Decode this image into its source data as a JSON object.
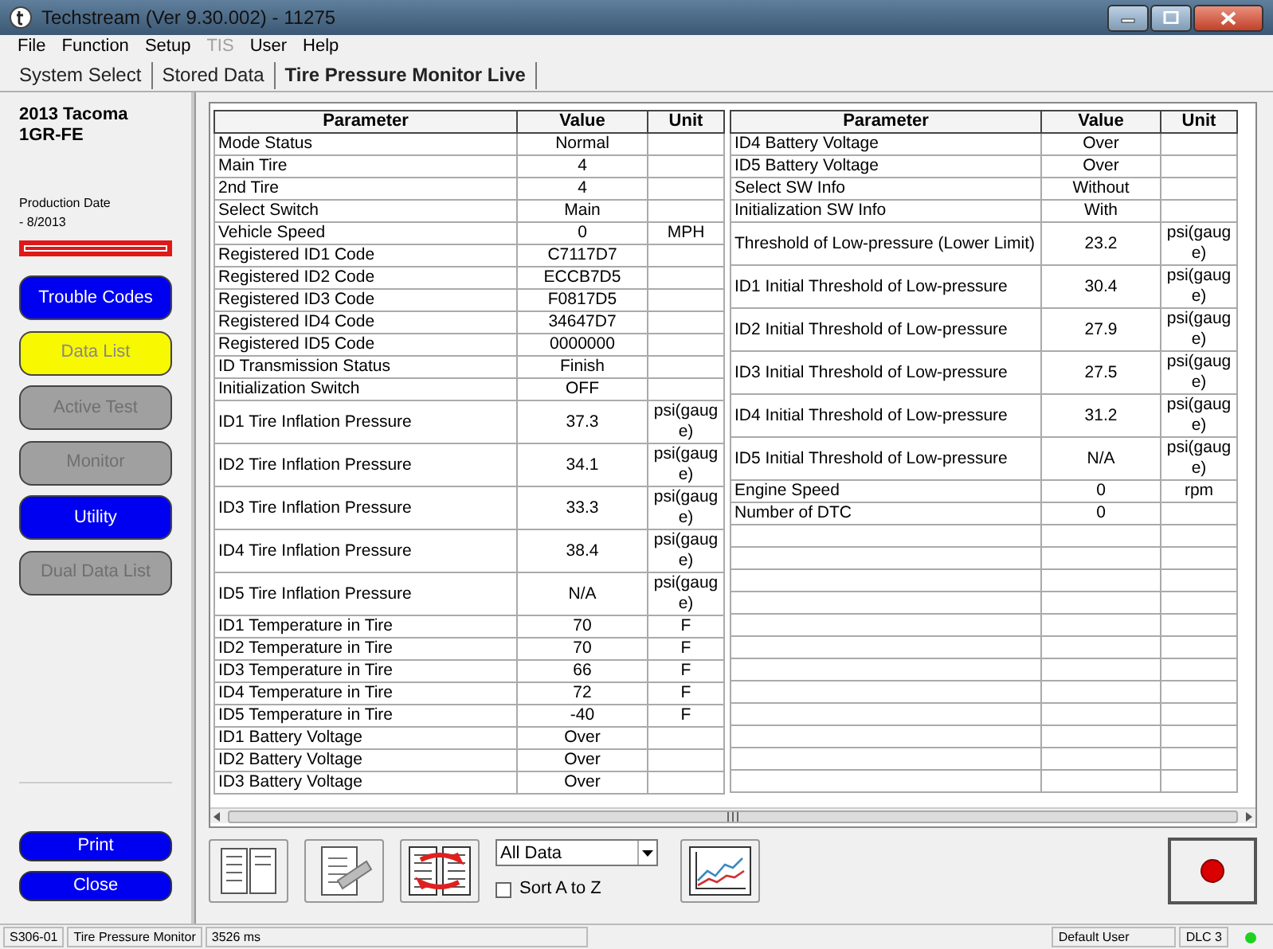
{
  "window": {
    "title": "Techstream (Ver 9.30.002) - 11275"
  },
  "menu": [
    {
      "label": "File",
      "disabled": false
    },
    {
      "label": "Function",
      "disabled": false
    },
    {
      "label": "Setup",
      "disabled": false
    },
    {
      "label": "TIS",
      "disabled": true
    },
    {
      "label": "User",
      "disabled": false
    },
    {
      "label": "Help",
      "disabled": false
    }
  ],
  "tabs": [
    {
      "label": "System Select",
      "selected": false
    },
    {
      "label": "Stored Data",
      "selected": false
    },
    {
      "label": "Tire Pressure Monitor Live",
      "selected": true
    }
  ],
  "vehicle": {
    "model": "2013 Tacoma",
    "engine": "1GR-FE",
    "production_label": "Production Date",
    "production_value": "- 8/2013"
  },
  "function_buttons": [
    {
      "label": "Trouble Codes",
      "selected": false,
      "disabled": false
    },
    {
      "label": "Data List",
      "selected": true,
      "disabled": false
    },
    {
      "label": "Active Test",
      "selected": false,
      "disabled": true
    },
    {
      "label": "Monitor",
      "selected": false,
      "disabled": true
    },
    {
      "label": "Utility",
      "selected": false,
      "disabled": false
    },
    {
      "label": "Dual Data List",
      "selected": false,
      "disabled": true
    }
  ],
  "action_buttons": [
    "Print",
    "Close"
  ],
  "tables": [
    {
      "columns": [
        "Parameter",
        "Value",
        "Unit"
      ],
      "rows": [
        {
          "parameter": "Mode Status",
          "value": "Normal",
          "unit": ""
        },
        {
          "parameter": "Main Tire",
          "value": "4",
          "unit": ""
        },
        {
          "parameter": "2nd Tire",
          "value": "4",
          "unit": ""
        },
        {
          "parameter": "Select Switch",
          "value": "Main",
          "unit": ""
        },
        {
          "parameter": "Vehicle Speed",
          "value": "0",
          "unit": "MPH"
        },
        {
          "parameter": "Registered ID1 Code",
          "value": "C7117D7",
          "unit": ""
        },
        {
          "parameter": "Registered ID2 Code",
          "value": "ECCB7D5",
          "unit": ""
        },
        {
          "parameter": "Registered ID3 Code",
          "value": "F0817D5",
          "unit": ""
        },
        {
          "parameter": "Registered ID4 Code",
          "value": "34647D7",
          "unit": ""
        },
        {
          "parameter": "Registered ID5 Code",
          "value": "0000000",
          "unit": ""
        },
        {
          "parameter": "ID Transmission Status",
          "value": "Finish",
          "unit": ""
        },
        {
          "parameter": "Initialization Switch",
          "value": "OFF",
          "unit": ""
        },
        {
          "parameter": "ID1 Tire Inflation Pressure",
          "value": "37.3",
          "unit": "psi(gauge)"
        },
        {
          "parameter": "ID2 Tire Inflation Pressure",
          "value": "34.1",
          "unit": "psi(gauge)"
        },
        {
          "parameter": "ID3 Tire Inflation Pressure",
          "value": "33.3",
          "unit": "psi(gauge)"
        },
        {
          "parameter": "ID4 Tire Inflation Pressure",
          "value": "38.4",
          "unit": "psi(gauge)"
        },
        {
          "parameter": "ID5 Tire Inflation Pressure",
          "value": "N/A",
          "unit": "psi(gauge)"
        },
        {
          "parameter": "ID1 Temperature in Tire",
          "value": "70",
          "unit": "F"
        },
        {
          "parameter": "ID2 Temperature in Tire",
          "value": "70",
          "unit": "F"
        },
        {
          "parameter": "ID3 Temperature in Tire",
          "value": "66",
          "unit": "F"
        },
        {
          "parameter": "ID4 Temperature in Tire",
          "value": "72",
          "unit": "F"
        },
        {
          "parameter": "ID5 Temperature in Tire",
          "value": "-40",
          "unit": "F"
        },
        {
          "parameter": "ID1 Battery Voltage",
          "value": "Over",
          "unit": ""
        },
        {
          "parameter": "ID2 Battery Voltage",
          "value": "Over",
          "unit": ""
        },
        {
          "parameter": "ID3 Battery Voltage",
          "value": "Over",
          "unit": ""
        }
      ]
    },
    {
      "columns": [
        "Parameter",
        "Value",
        "Unit"
      ],
      "rows": [
        {
          "parameter": "ID4 Battery Voltage",
          "value": "Over",
          "unit": ""
        },
        {
          "parameter": "ID5 Battery Voltage",
          "value": "Over",
          "unit": ""
        },
        {
          "parameter": "Select SW Info",
          "value": "Without",
          "unit": ""
        },
        {
          "parameter": "Initialization SW Info",
          "value": "With",
          "unit": ""
        },
        {
          "parameter": "Threshold of Low-pressure (Lower Limit)",
          "value": "23.2",
          "unit": "psi(gauge)"
        },
        {
          "parameter": "ID1 Initial Threshold of Low-pressure",
          "value": "30.4",
          "unit": "psi(gauge)"
        },
        {
          "parameter": "ID2 Initial Threshold of Low-pressure",
          "value": "27.9",
          "unit": "psi(gauge)"
        },
        {
          "parameter": "ID3 Initial Threshold of Low-pressure",
          "value": "27.5",
          "unit": "psi(gauge)"
        },
        {
          "parameter": "ID4 Initial Threshold of Low-pressure",
          "value": "31.2",
          "unit": "psi(gauge)"
        },
        {
          "parameter": "ID5 Initial Threshold of Low-pressure",
          "value": "N/A",
          "unit": "psi(gauge)"
        },
        {
          "parameter": "Engine Speed",
          "value": "0",
          "unit": "rpm"
        },
        {
          "parameter": "Number of DTC",
          "value": "0",
          "unit": ""
        }
      ]
    }
  ],
  "toolbar": {
    "data_filter": {
      "value": "All Data"
    },
    "sort": {
      "label": "Sort A to Z",
      "checked": false
    }
  },
  "status_bar": {
    "fields": [
      "S306-01",
      "Tire Pressure Monitor",
      "3526 ms",
      "Default User",
      "DLC 3"
    ],
    "connected": true
  }
}
